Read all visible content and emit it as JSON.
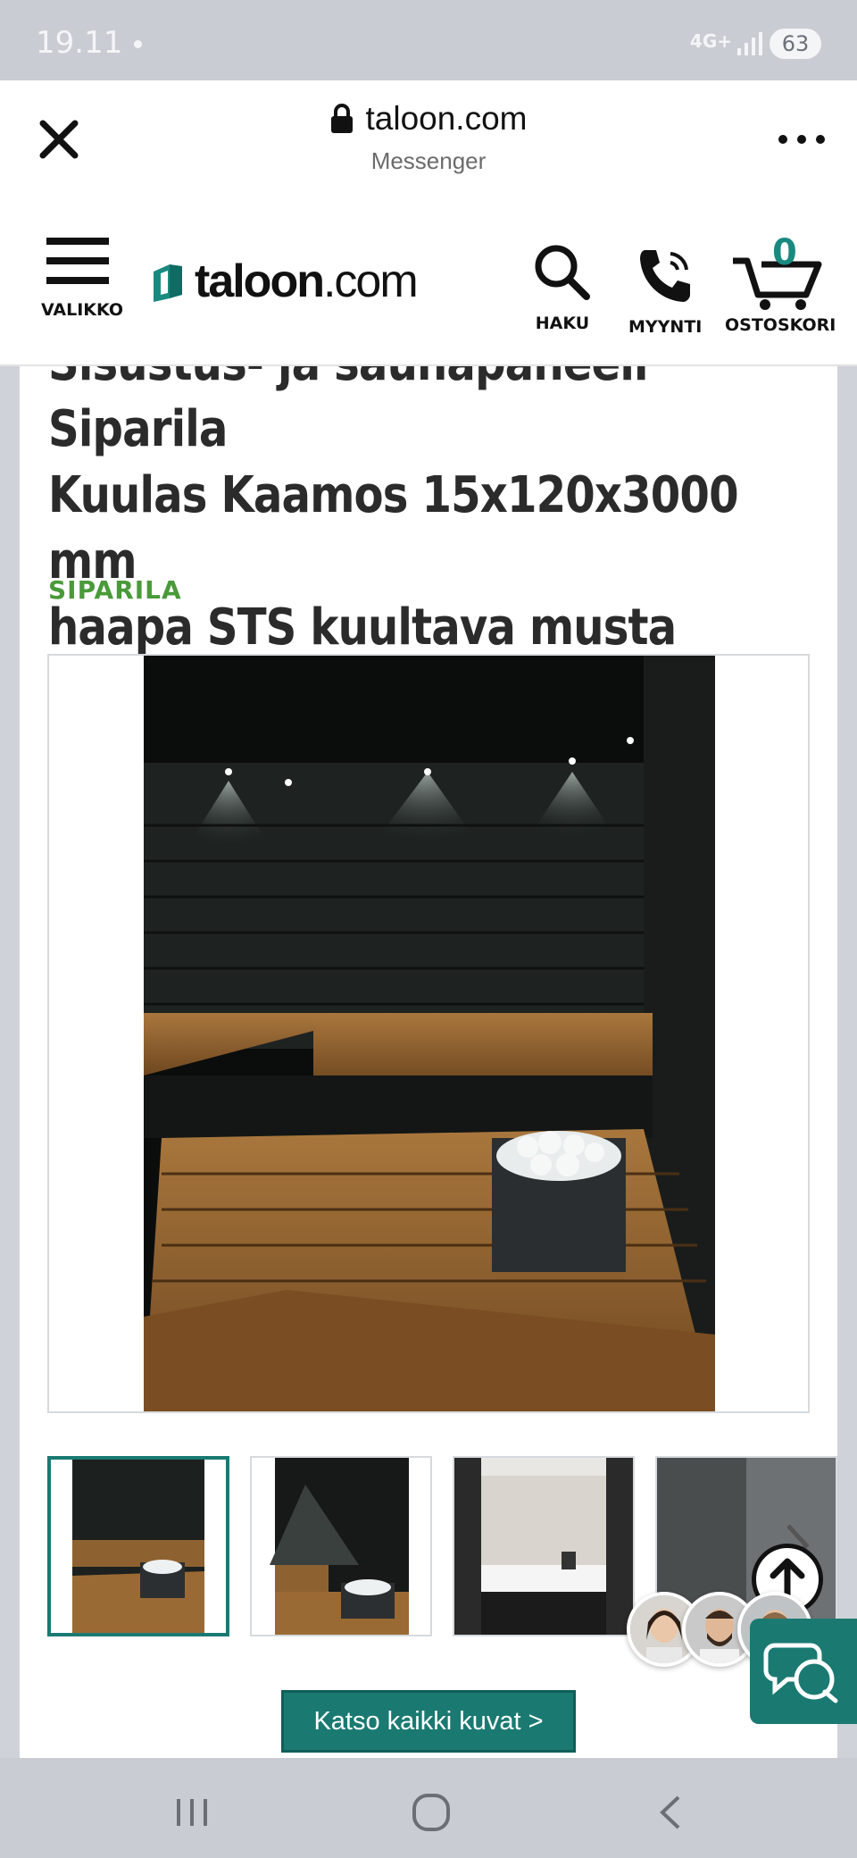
{
  "status_bar": {
    "time": "19.11",
    "network": "4G+",
    "battery": "63"
  },
  "browser": {
    "url": "taloon.com",
    "subtitle": "Messenger"
  },
  "header": {
    "menu_label": "VALIKKO",
    "logo_bold": "taloon",
    "logo_light": ".com",
    "search_label": "HAKU",
    "sales_label": "MYYNTI",
    "cart_label": "OSTOSKORI",
    "cart_count": "0"
  },
  "product": {
    "title_line1": "Sisustus- ja saunapaneeli Siparila",
    "title_line2": "Kuulas Kaamos 15x120x3000 mm",
    "title_line3": "haapa STS kuultava musta",
    "brand": "SIPARILA"
  },
  "gallery": {
    "see_all_label": "Katso kaikki kuvat >"
  },
  "colors": {
    "accent": "#1a7a72",
    "brand_green": "#4a9a3a",
    "status_bar": "#c9ccd2"
  }
}
